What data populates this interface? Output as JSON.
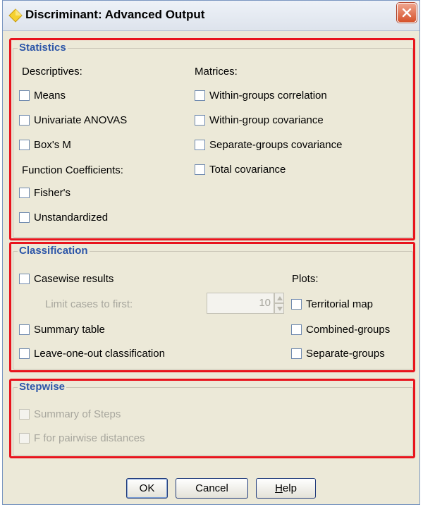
{
  "window": {
    "title": "Discriminant: Advanced Output"
  },
  "statistics": {
    "legend": "Statistics",
    "descriptives_label": "Descriptives:",
    "means": "Means",
    "univariate": "Univariate ANOVAS",
    "boxm": "Box's M",
    "function_label": "Function Coefficients:",
    "fisher": "Fisher's",
    "unstandardized": "Unstandardized",
    "matrices_label": "Matrices:",
    "within_corr": "Within-groups correlation",
    "within_cov": "Within-group covariance",
    "separate_cov": "Separate-groups covariance",
    "total_cov": "Total covariance"
  },
  "classification": {
    "legend": "Classification",
    "casewise": "Casewise results",
    "limit_label": "Limit cases to first:",
    "limit_value": "10",
    "summary_table": "Summary table",
    "leave_one_out": "Leave-one-out classification",
    "plots_label": "Plots:",
    "territorial": "Territorial map",
    "combined": "Combined-groups",
    "separate": "Separate-groups"
  },
  "stepwise": {
    "legend": "Stepwise",
    "summary_steps": "Summary of Steps",
    "f_pairwise": "F for pairwise distances"
  },
  "buttons": {
    "ok": "OK",
    "cancel": "Cancel",
    "help_prefix": "",
    "help_mnemonic": "H",
    "help_rest": "elp"
  },
  "colors": {
    "highlight": "#e8141d",
    "legend_text": "#2d56a8",
    "dialog_bg": "#ece9d8"
  }
}
